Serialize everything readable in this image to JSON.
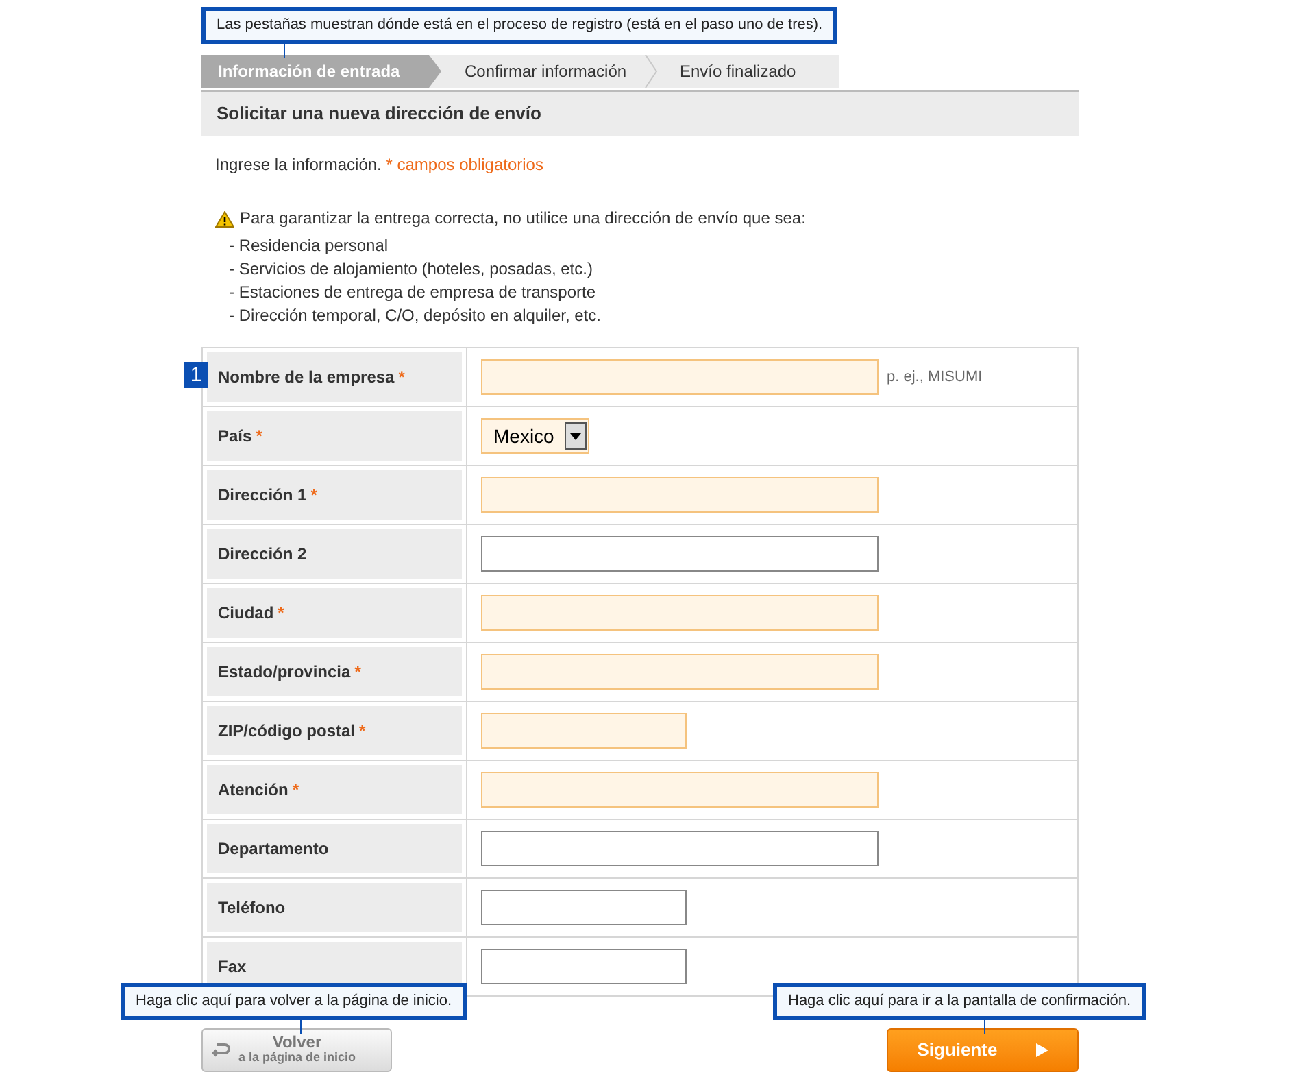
{
  "callouts": {
    "tabs": "Las pestañas muestran dónde está en el proceso de registro (está en el paso uno de tres).",
    "back": "Haga clic aquí para volver a la página de inicio.",
    "next": "Haga clic aquí para ir a la pantalla de confirmación."
  },
  "steps": [
    {
      "label": "Información de entrada",
      "selected": true
    },
    {
      "label": "Confirmar información",
      "selected": false
    },
    {
      "label": "Envío finalizado",
      "selected": false
    }
  ],
  "heading": "Solicitar una nueva dirección de envío",
  "intro": "Ingrese la información.",
  "required_note": "* campos obligatorios",
  "warning": "Para garantizar la entrega correcta, no utilice una dirección de envío que sea:",
  "warning_items": [
    "- Residencia personal",
    "- Servicios de alojamiento (hoteles, posadas, etc.)",
    "- Estaciones de entrega de empresa de transporte",
    "- Dirección temporal, C/O, depósito en alquiler, etc."
  ],
  "step_badge": "1",
  "required_mark": "*",
  "fields": [
    {
      "label": "Nombre de la empresa",
      "required": true,
      "kind": "wide_text",
      "hint": "p. ej., MISUMI"
    },
    {
      "label": "País",
      "required": true,
      "kind": "select",
      "value": "Mexico"
    },
    {
      "label": "Dirección 1",
      "required": true,
      "kind": "wide_text"
    },
    {
      "label": "Dirección 2",
      "required": false,
      "kind": "wide_text"
    },
    {
      "label": "Ciudad",
      "required": true,
      "kind": "wide_text"
    },
    {
      "label": "Estado/provincia",
      "required": true,
      "kind": "wide_text"
    },
    {
      "label": "ZIP/código postal",
      "required": true,
      "kind": "short_text"
    },
    {
      "label": "Atención",
      "required": true,
      "kind": "wide_text"
    },
    {
      "label": "Departamento",
      "required": false,
      "kind": "wide_text"
    },
    {
      "label": "Teléfono",
      "required": false,
      "kind": "short_text"
    },
    {
      "label": "Fax",
      "required": false,
      "kind": "short_text"
    }
  ],
  "back_button": {
    "title": "Volver",
    "subtitle": "a la página de inicio"
  },
  "next_button": "Siguiente"
}
